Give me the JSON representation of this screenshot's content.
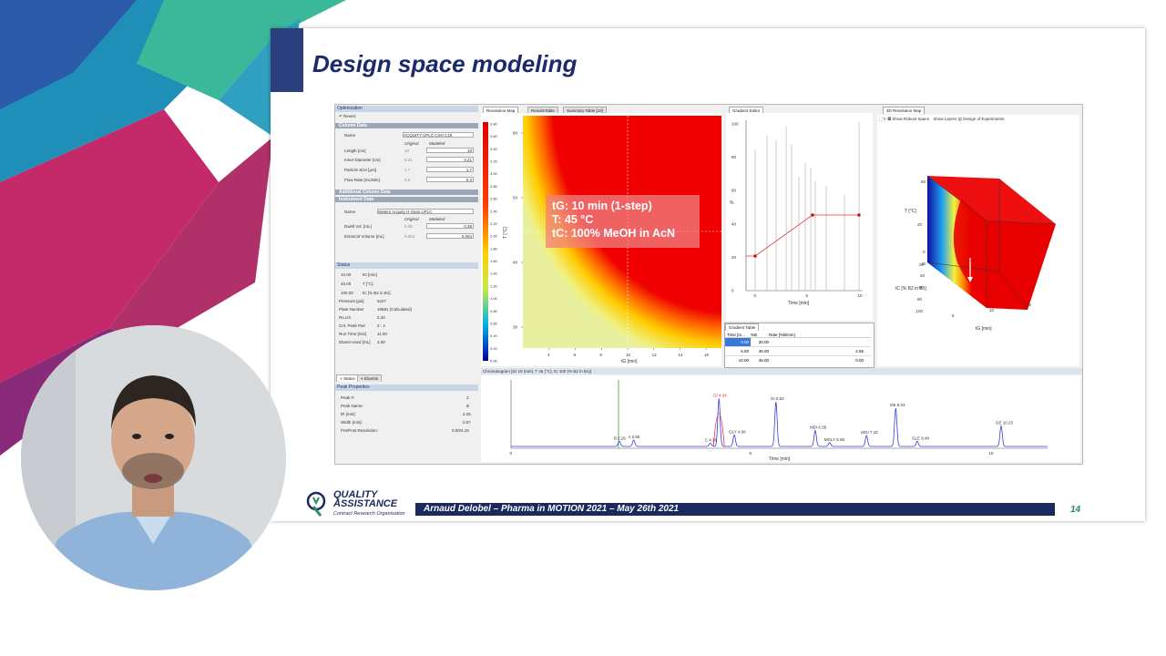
{
  "slide": {
    "title": "Design space modeling",
    "footer": "Arnaud Delobel – Pharma in MOTION 2021 – May 26th 2021",
    "page_number": "14",
    "logo_line1": "QUALITY",
    "logo_line2": "ASSISTANCE",
    "logo_sub": "Contract Research Organisation"
  },
  "optimization": {
    "header": "Optimization",
    "revert": "Revert",
    "column_data": "Column Data",
    "name_label": "Name",
    "column_name": "ACQUITY UPLC CSH C18",
    "col_original": "Original",
    "col_modeled": "Modeled",
    "length_label": "Length [cm]",
    "length_orig": "10",
    "length_mod": "10",
    "id_label": "Inner Diameter [cm]",
    "id_orig": "0.21",
    "id_mod": "0.21",
    "ps_label": "Particle Size [µm]",
    "ps_orig": "1.7",
    "ps_mod": "1.7",
    "flow_label": "Flow Rate [mL/Min]",
    "flow_orig": "0.3",
    "flow_mod": "0.3",
    "additional": "Additional Column Data",
    "instrument": "Instrument Data",
    "inst_name_label": "Name",
    "inst_name": "Waters Acquity H-class UPLC",
    "dwell_label": "Dwell Vol. [mL]",
    "dwell_orig": "0.38",
    "dwell_mod": "0.38",
    "extra_label": "ExtraCol Volume [mL]",
    "extra_orig": "0.004",
    "extra_mod": "0.004"
  },
  "status": {
    "header": "Status",
    "rows": [
      {
        "v": "10.00",
        "k": "tG [min]"
      },
      {
        "v": "45.00",
        "k": "T [°C]"
      },
      {
        "v": "100.00",
        "k": "tC [% B2 in B1]"
      }
    ],
    "rows2": [
      {
        "k": "Pressure [psi]",
        "v": "5227"
      },
      {
        "k": "Plate Number",
        "v": "19581    (Calculated)"
      },
      {
        "k": "Rs,crit",
        "v": "2.34"
      },
      {
        "k": "Crit. Peak Pair",
        "v": "3 : 4"
      },
      {
        "k": "Run Time [min]",
        "v": "11.00"
      },
      {
        "k": "Eluent Used [mL]",
        "v": "3.30"
      }
    ],
    "tab_status": "Status",
    "tab_eluents": "Eluents"
  },
  "peak_properties": {
    "header": "Peak Properties",
    "rows": [
      {
        "k": "Peak #:",
        "v": "2"
      },
      {
        "k": "Peak Name:",
        "v": "B"
      },
      {
        "k": "tR [min]:",
        "v": "2.26"
      },
      {
        "k": "Width [min]:",
        "v": "0.07"
      },
      {
        "k": "Pre/Post Resolution:",
        "v": "0.00/4.15"
      }
    ]
  },
  "resolution_map": {
    "tabs": [
      "Resolution Map",
      "ResultsTable",
      "Summary Table [10]"
    ],
    "colorbar_ticks": [
      "3.80",
      "3.60",
      "3.40",
      "3.20",
      "3.00",
      "2.80",
      "2.60",
      "2.40",
      "2.20",
      "2.00",
      "1.80",
      "1.60",
      "1.40",
      "1.20",
      "1.00",
      "0.80",
      "0.60",
      "0.40",
      "0.20",
      "0.00"
    ],
    "y_ticks": [
      "60",
      "50",
      "40",
      "30"
    ],
    "x_ticks": [
      "4",
      "6",
      "8",
      "10",
      "12",
      "14",
      "16"
    ],
    "y_label": "T [°C]",
    "x_label": "tG [min]"
  },
  "overlay": {
    "line1": "tG: 10 min (1-step)",
    "line2": "T:  45 °C",
    "line3": "tC: 100% MeOH in AcN"
  },
  "gradient_editor": {
    "tab": "Gradient Editor",
    "x_ticks": [
      "0",
      "5",
      "10"
    ],
    "y_ticks": [
      "100",
      "80",
      "60",
      "40",
      "20",
      "0"
    ],
    "x_label": "Time [min]",
    "y_label": "%",
    "table_tab": "Gradient Table",
    "headers": [
      "Time [m...",
      "%B",
      "Rate [%B/min]"
    ],
    "rows": [
      [
        "0.00",
        "30.00",
        ""
      ],
      [
        "5.50",
        "45.00",
        "4.55"
      ],
      [
        "10.00",
        "45.00",
        "0.00"
      ]
    ]
  },
  "map3d": {
    "tab": "3D Resolution Map",
    "show_robust": "Show Robust Space",
    "show_layers": "Show Layers",
    "doe": "Design of Experiments",
    "t_label": "T [°C]",
    "tc_label": "tC [% B2 in B1]",
    "tg_label": "tG [min]",
    "t_ticks": [
      "60",
      "40",
      "20"
    ],
    "tc_ticks": [
      "0",
      "20",
      "40",
      "60",
      "80",
      "100"
    ],
    "tg_ticks": [
      "5",
      "10",
      "15"
    ]
  },
  "chromatogram": {
    "header": "Chromatogram [tG 10 (min), T 45 (°C), tC 100 (% B2 in B1)]",
    "x_label": "Time [min]",
    "x_ticks": [
      "0",
      "5",
      "10"
    ],
    "peaks": [
      {
        "label": "B 2.26",
        "t": 2.26,
        "h": 0.08
      },
      {
        "label": "A 2.56",
        "t": 2.56,
        "h": 0.1
      },
      {
        "label": "C 4.16",
        "t": 4.16,
        "h": 0.05
      },
      {
        "label": "DI 4.34",
        "t": 4.34,
        "h": 0.75
      },
      {
        "label": "GLY 4.66",
        "t": 4.66,
        "h": 0.18
      },
      {
        "label": "GI 5.53",
        "t": 5.53,
        "h": 0.7
      },
      {
        "label": "MDI 6.35",
        "t": 6.35,
        "h": 0.25
      },
      {
        "label": "MGLY 6.65",
        "t": 6.65,
        "h": 0.06
      },
      {
        "label": "MGI 7.42",
        "t": 7.42,
        "h": 0.17
      },
      {
        "label": "DE 8.03",
        "t": 8.03,
        "h": 0.6
      },
      {
        "label": "GLE 8.48",
        "t": 8.48,
        "h": 0.08
      },
      {
        "label": "GE 10.23",
        "t": 10.23,
        "h": 0.32
      }
    ]
  },
  "colors": {
    "accent": "#1a2a5c",
    "title": "#1a2a6c",
    "teal": "#2a8a6a"
  }
}
